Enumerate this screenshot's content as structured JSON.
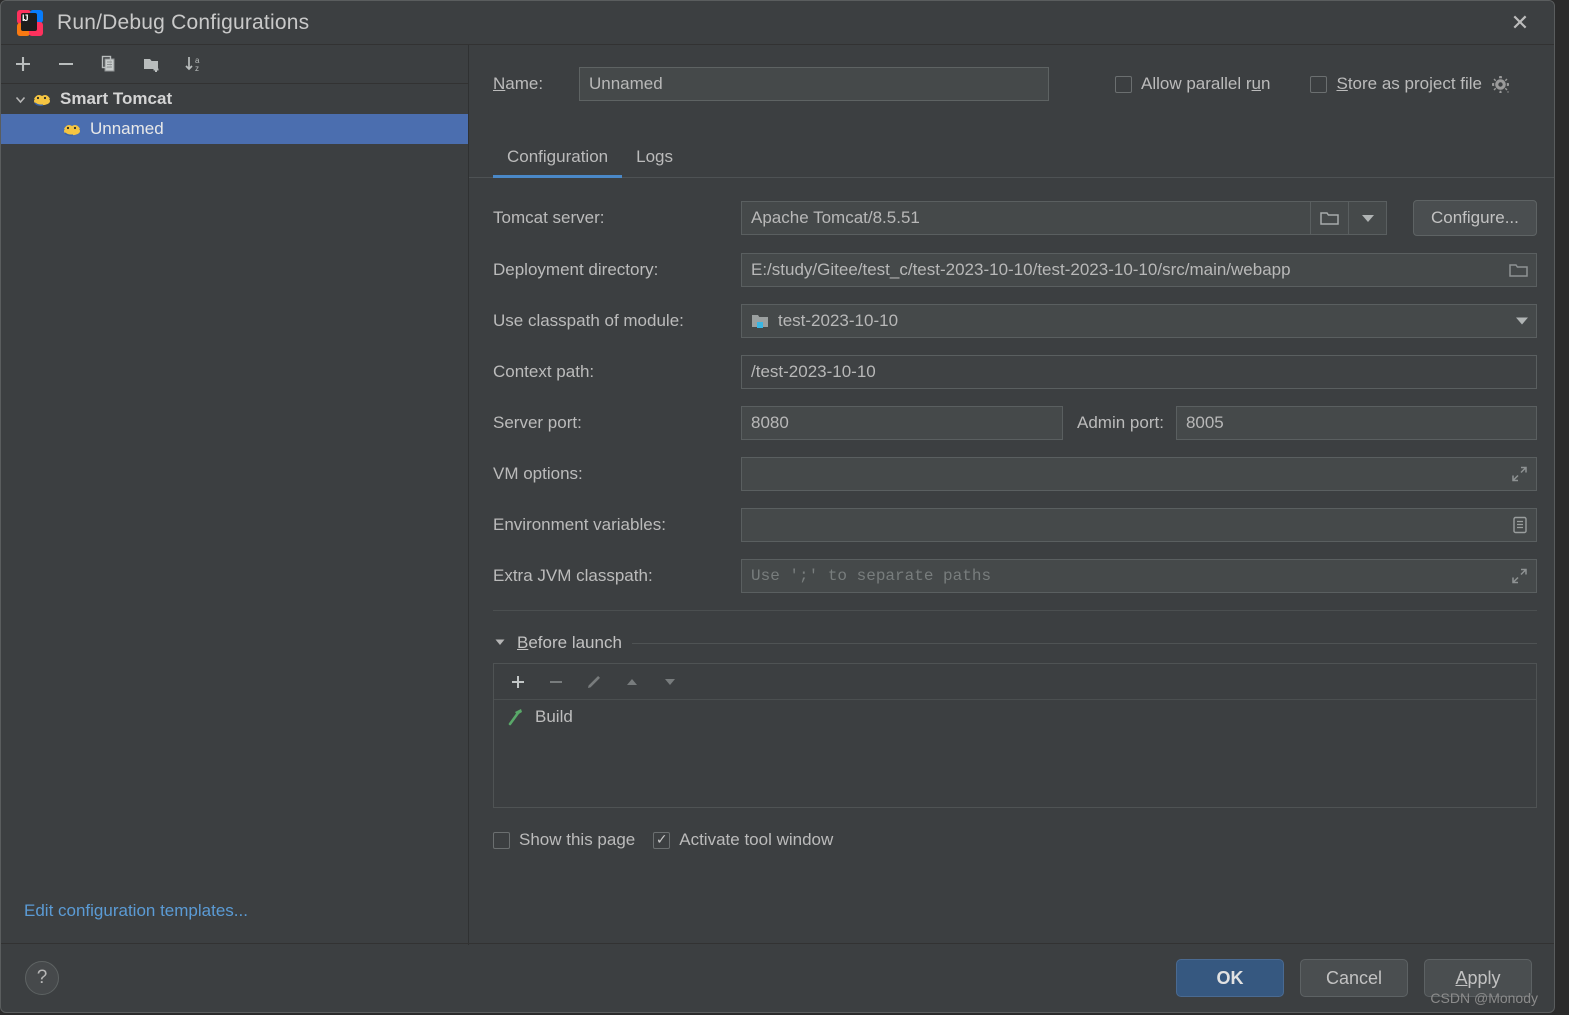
{
  "window": {
    "title": "Run/Debug Configurations",
    "close_label": "✕",
    "app_icon": "intellij-idea-icon"
  },
  "left_panel": {
    "toolbar": [
      {
        "name": "add-configuration-button",
        "icon": "plus-icon"
      },
      {
        "name": "remove-configuration-button",
        "icon": "minus-icon"
      },
      {
        "name": "copy-configuration-button",
        "icon": "copy-icon"
      },
      {
        "name": "add-folder-button",
        "icon": "folder-add-icon"
      },
      {
        "name": "sort-configurations-button",
        "icon": "sort-alphabetical-icon"
      }
    ],
    "tree": [
      {
        "label": "Smart Tomcat",
        "type": "group",
        "expanded": true,
        "icon": "tomcat-icon"
      },
      {
        "label": "Unnamed",
        "type": "child",
        "selected": true,
        "icon": "tomcat-icon"
      }
    ],
    "edit_templates_link": "Edit configuration templates..."
  },
  "header": {
    "name_label": "Name:",
    "name_value": "Unnamed",
    "allow_parallel_run": {
      "label": "Allow parallel run",
      "checked": false
    },
    "store_as_project_file": {
      "label": "Store as project file",
      "checked": false
    },
    "gear_icon": "gear-icon"
  },
  "tabs": [
    {
      "label": "Configuration",
      "active": true
    },
    {
      "label": "Logs",
      "active": false
    }
  ],
  "form": {
    "tomcat_server": {
      "label": "Tomcat server:",
      "value": "Apache Tomcat/8.5.51",
      "browse_icon": "folder-icon",
      "dropdown_icon": "chevron-down-icon",
      "configure_button": "Configure..."
    },
    "deployment_directory": {
      "label": "Deployment directory:",
      "value": "E:/study/Gitee/test_c/test-2023-10-10/test-2023-10-10/src/main/webapp",
      "browse_icon": "folder-icon"
    },
    "use_classpath_of_module": {
      "label": "Use classpath of module:",
      "value": "test-2023-10-10",
      "module_icon": "module-icon",
      "dropdown_icon": "chevron-down-icon"
    },
    "context_path": {
      "label": "Context path:",
      "value": "/test-2023-10-10"
    },
    "server_port": {
      "label": "Server port:",
      "value": "8080"
    },
    "admin_port": {
      "label": "Admin port:",
      "value": "8005"
    },
    "vm_options": {
      "label": "VM options:",
      "value": "",
      "expand_icon": "expand-icon"
    },
    "environment_variables": {
      "label": "Environment variables:",
      "value": "",
      "browse_icon": "list-edit-icon"
    },
    "extra_jvm_classpath": {
      "label": "Extra JVM classpath:",
      "value": "",
      "placeholder": "Use ';' to separate paths",
      "expand_icon": "expand-icon"
    }
  },
  "before_launch": {
    "title": "Before launch",
    "expanded": true,
    "twisty_icon": "triangle-down-icon",
    "toolbar": [
      {
        "name": "add-task-button",
        "icon": "plus-icon",
        "enabled": true
      },
      {
        "name": "remove-task-button",
        "icon": "minus-icon",
        "enabled": false
      },
      {
        "name": "edit-task-button",
        "icon": "pencil-icon",
        "enabled": false
      },
      {
        "name": "move-task-up-button",
        "icon": "triangle-up-icon",
        "enabled": false
      },
      {
        "name": "move-task-down-button",
        "icon": "triangle-down-icon",
        "enabled": false
      }
    ],
    "tasks": [
      {
        "label": "Build",
        "icon": "hammer-icon"
      }
    ]
  },
  "bottom_checks": {
    "show_this_page": {
      "label": "Show this page",
      "checked": false
    },
    "activate_tool_window": {
      "label": "Activate tool window",
      "checked": true
    }
  },
  "footer": {
    "help_label": "?",
    "ok_label": "OK",
    "cancel_label": "Cancel",
    "apply_label": "Apply"
  },
  "watermark": "CSDN @Monody",
  "colors": {
    "dialog_bg": "#3c3f41",
    "field_bg": "#45494a",
    "selection_blue": "#4b6eaf",
    "accent_blue": "#4a88c7",
    "ok_button": "#365880",
    "link_blue": "#5b9bd5",
    "hammer_green": "#59a869",
    "module_badge": "#3ab6e3"
  }
}
